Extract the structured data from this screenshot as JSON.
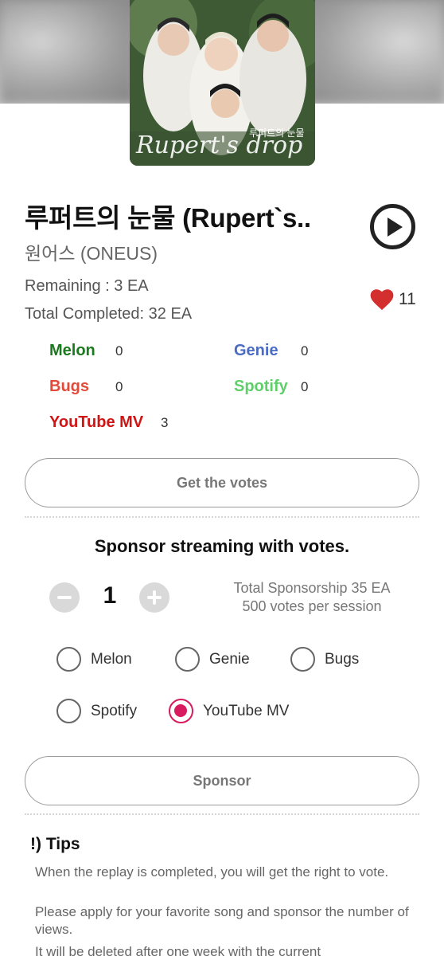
{
  "song": {
    "title": "루퍼트의 눈물 (Rupert`s..",
    "artist": "원어스 (ONEUS)",
    "remaining": "Remaining : 3 EA",
    "total_completed": "Total Completed: 32 EA",
    "likes": "11",
    "cover_text": "Rupert's drop",
    "cover_korean": "루퍼트의 눈물"
  },
  "streams": [
    {
      "name": "Melon",
      "value": "0",
      "color": "#1b7a1e"
    },
    {
      "name": "Genie",
      "value": "0",
      "color": "#4b6cc4"
    },
    {
      "name": "Bugs",
      "value": "0",
      "color": "#e24b3a"
    },
    {
      "name": "Spotify",
      "value": "0",
      "color": "#5fcf6a"
    },
    {
      "name": "YouTube MV",
      "value": "3",
      "color": "#d11414"
    }
  ],
  "buttons": {
    "get_votes": "Get the votes",
    "sponsor": "Sponsor"
  },
  "sponsor": {
    "heading": "Sponsor streaming with votes.",
    "quantity": "1",
    "total": "Total Sponsorship 35 EA",
    "per_session": "500 votes per session",
    "options": [
      "Melon",
      "Genie",
      "Bugs",
      "Spotify",
      "YouTube MV"
    ],
    "selected": "YouTube MV"
  },
  "tips": {
    "title": "!) Tips",
    "lines": [
      "When the replay is completed, you will get the right to vote.",
      "Please apply for your favorite song and sponsor the number of views.",
      "It will be deleted after one week with the current"
    ]
  },
  "colors": {
    "accent": "#d81b60",
    "heart": "#d32f2f"
  }
}
